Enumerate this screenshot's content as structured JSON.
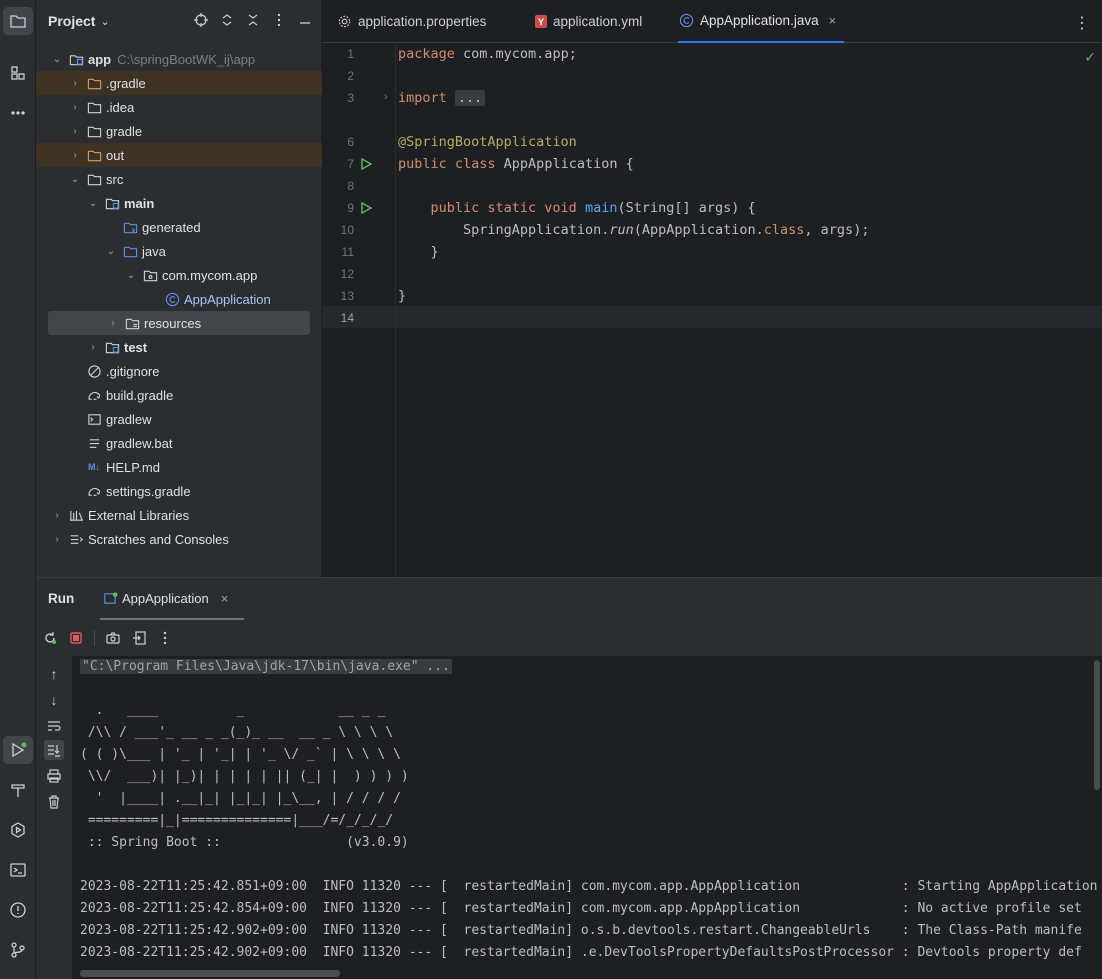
{
  "project_panel": {
    "title": "Project",
    "title_arrow": "⌄",
    "header_icons": [
      "crosshair-icon",
      "expand-icon",
      "collapse-icon",
      "more-icon",
      "hide-icon"
    ],
    "tree": [
      {
        "label": "app",
        "path": "C:\\springBootWK_ij\\app",
        "icon": "module-folder-icon",
        "arrow": "⌄"
      },
      {
        "label": ".gradle",
        "icon": "folder-icon",
        "arrow": "›"
      },
      {
        "label": ".idea",
        "icon": "folder-icon",
        "arrow": "›"
      },
      {
        "label": "gradle",
        "icon": "folder-icon",
        "arrow": "›"
      },
      {
        "label": "out",
        "icon": "folder-icon",
        "arrow": "›"
      },
      {
        "label": "src",
        "icon": "folder-icon",
        "arrow": "⌄"
      },
      {
        "label": "main",
        "icon": "module-folder-icon",
        "arrow": "⌄"
      },
      {
        "label": "generated",
        "icon": "source-folder-icon",
        "arrow": ""
      },
      {
        "label": "java",
        "icon": "source-folder-icon",
        "arrow": "⌄"
      },
      {
        "label": "com.mycom.app",
        "icon": "package-icon",
        "arrow": "⌄"
      },
      {
        "label": "AppApplication",
        "icon": "class-icon",
        "arrow": ""
      },
      {
        "label": "resources",
        "icon": "resources-folder-icon",
        "arrow": "›"
      },
      {
        "label": "test",
        "icon": "module-folder-icon",
        "arrow": "›"
      },
      {
        "label": ".gitignore",
        "icon": "ignore-file-icon",
        "arrow": ""
      },
      {
        "label": "build.gradle",
        "icon": "gradle-icon",
        "arrow": ""
      },
      {
        "label": "gradlew",
        "icon": "terminal-file-icon",
        "arrow": ""
      },
      {
        "label": "gradlew.bat",
        "icon": "text-file-icon",
        "arrow": ""
      },
      {
        "label": "HELP.md",
        "icon": "markdown-icon",
        "arrow": ""
      },
      {
        "label": "settings.gradle",
        "icon": "gradle-icon",
        "arrow": ""
      },
      {
        "label": "External Libraries",
        "icon": "library-icon",
        "arrow": "›"
      },
      {
        "label": "Scratches and Consoles",
        "icon": "scratches-icon",
        "arrow": "›"
      }
    ]
  },
  "editor_tabs": [
    {
      "label": "application.properties",
      "icon": "settings-file-icon"
    },
    {
      "label": "application.yml",
      "icon": "yaml-icon"
    },
    {
      "label": "AppApplication.java",
      "icon": "class-icon",
      "close": "×"
    }
  ],
  "editor": {
    "line_numbers": [
      "1",
      "2",
      "3",
      "6",
      "7",
      "8",
      "9",
      "10",
      "11",
      "12",
      "13",
      "14"
    ],
    "fold_marker": "›",
    "check_mark": "✓",
    "code": {
      "l1_kw": "package",
      "l1_rest": " com.mycom.app;",
      "l3_kw": "import",
      "l3_fold": "...",
      "l6_ann": "@SpringBootApplication",
      "l7_kw": "public class",
      "l7_rest": " AppApplication {",
      "l9_indent": "    ",
      "l9_kw": "public static void",
      "l9_fn": "main",
      "l9_rest": "(String[] args) {",
      "l10_indent": "        ",
      "l10_cls": "SpringApplication.",
      "l10_fn": "run",
      "l10_mid": "(AppApplication.",
      "l10_kw": "class",
      "l10_end": ", args);",
      "l11": "    }",
      "l13": "}"
    }
  },
  "run_panel": {
    "title": "Run",
    "tab_label": "AppApplication",
    "tab_close": "×",
    "console": [
      "\"C:\\Program Files\\Java\\jdk-17\\bin\\java.exe\" ...",
      "",
      "  .   ____          _            __ _ _",
      " /\\\\ / ___'_ __ _ _(_)_ __  __ _ \\ \\ \\ \\",
      "( ( )\\___ | '_ | '_| | '_ \\/ _` | \\ \\ \\ \\",
      " \\\\/  ___)| |_)| | | | | || (_| |  ) ) ) )",
      "  '  |____| .__|_| |_|_| |_\\__, | / / / /",
      " =========|_|==============|___/=/_/_/_/",
      " :: Spring Boot ::                (v3.0.9)",
      "",
      "2023-08-22T11:25:42.851+09:00  INFO 11320 --- [  restartedMain] com.mycom.app.AppApplication             : Starting AppApplication",
      "2023-08-22T11:25:42.854+09:00  INFO 11320 --- [  restartedMain] com.mycom.app.AppApplication             : No active profile set",
      "2023-08-22T11:25:42.902+09:00  INFO 11320 --- [  restartedMain] o.s.b.devtools.restart.ChangeableUrls    : The Class-Path manife",
      "2023-08-22T11:25:42.902+09:00  INFO 11320 --- [  restartedMain] .e.DevToolsPropertyDefaultsPostProcessor : Devtools property def"
    ]
  }
}
